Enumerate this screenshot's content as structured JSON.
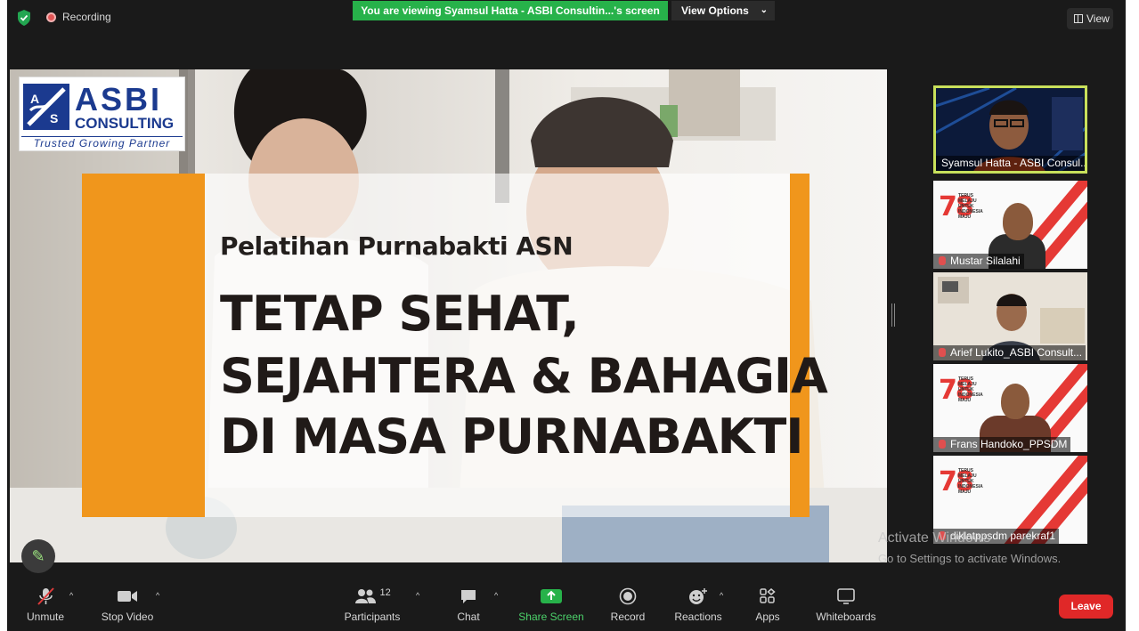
{
  "topbar": {
    "recording_label": "Recording",
    "share_banner": "You are viewing Syamsul Hatta - ASBI Consultin...'s screen",
    "view_options_label": "View Options",
    "view_label": "View"
  },
  "slide": {
    "logo_line1": "ASBI",
    "logo_line2": "CONSULTING",
    "logo_tagline": "Trusted Growing Partner",
    "subtitle": "Pelatihan Purnabakti ASN",
    "headline_line1": "TETAP SEHAT,",
    "headline_line2": "SEJAHTERA & BAHAGIA",
    "headline_line3": "DI MASA PURNABAKTI",
    "accent_color": "#f0961c"
  },
  "gallery": {
    "participants": [
      {
        "name": "Syamsul Hatta - ASBI Consul...",
        "active": true
      },
      {
        "name": "Mustar Silalahi",
        "muted": true
      },
      {
        "name": "Arief Lukito_ASBI Consult...",
        "muted": true
      },
      {
        "name": "Frans Handoko_PPSDM",
        "muted": true
      },
      {
        "name": "diklatppsdm parekraf1",
        "muted": true
      }
    ],
    "tile_small_text": "TERUS MELAJU UNTUK INDONESIA MAJU"
  },
  "watermark": {
    "line1": "Activate Windows",
    "line2": "Go to Settings to activate Windows."
  },
  "toolbar": {
    "unmute": "Unmute",
    "stop_video": "Stop Video",
    "participants": "Participants",
    "participants_count": "12",
    "chat": "Chat",
    "share_screen": "Share Screen",
    "record": "Record",
    "reactions": "Reactions",
    "apps": "Apps",
    "whiteboards": "Whiteboards",
    "leave": "Leave"
  },
  "colors": {
    "share_green": "#27b24a",
    "leave_red": "#e02828",
    "active_speaker_border": "#c8e05b"
  }
}
